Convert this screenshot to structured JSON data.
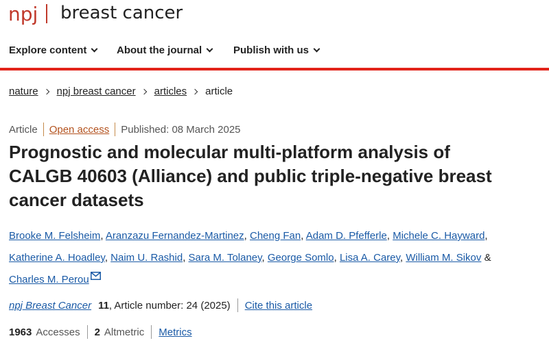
{
  "masthead": {
    "brand": "npj",
    "journal": "breast cancer"
  },
  "nav": {
    "items": [
      {
        "label": "Explore content"
      },
      {
        "label": "About the journal"
      },
      {
        "label": "Publish with us"
      }
    ]
  },
  "breadcrumb": {
    "items": [
      "nature",
      "npj breast cancer",
      "articles"
    ],
    "current": "article"
  },
  "meta": {
    "type": "Article",
    "access": "Open access",
    "published": "Published: 08 March 2025"
  },
  "title": "Prognostic and molecular multi-platform analysis of CALGB 40603 (Alliance) and public triple-negative breast cancer datasets",
  "authors": [
    "Brooke M. Felsheim",
    "Aranzazu Fernandez-Martinez",
    "Cheng Fan",
    "Adam D. Pfefferle",
    "Michele C. Hayward",
    "Katherine A. Hoadley",
    "Naim U. Rashid",
    "Sara M. Tolaney",
    "George Somlo",
    "Lisa A. Carey",
    "William M. Sikov",
    "Charles M. Perou"
  ],
  "authors_and": "&",
  "citation": {
    "journal": "npj Breast Cancer",
    "volume": "11",
    "article_number": ", Article number: 24 (2025)",
    "cite_link": "Cite this article"
  },
  "stats": {
    "accesses_value": "1963",
    "accesses_label": "Accesses",
    "altmetric_value": "2",
    "altmetric_label": "Altmetric",
    "metrics_link": "Metrics"
  },
  "colors": {
    "brand_red": "#e2231a",
    "link_blue": "#1a5aa6",
    "open_access_orange": "#b3521e"
  }
}
